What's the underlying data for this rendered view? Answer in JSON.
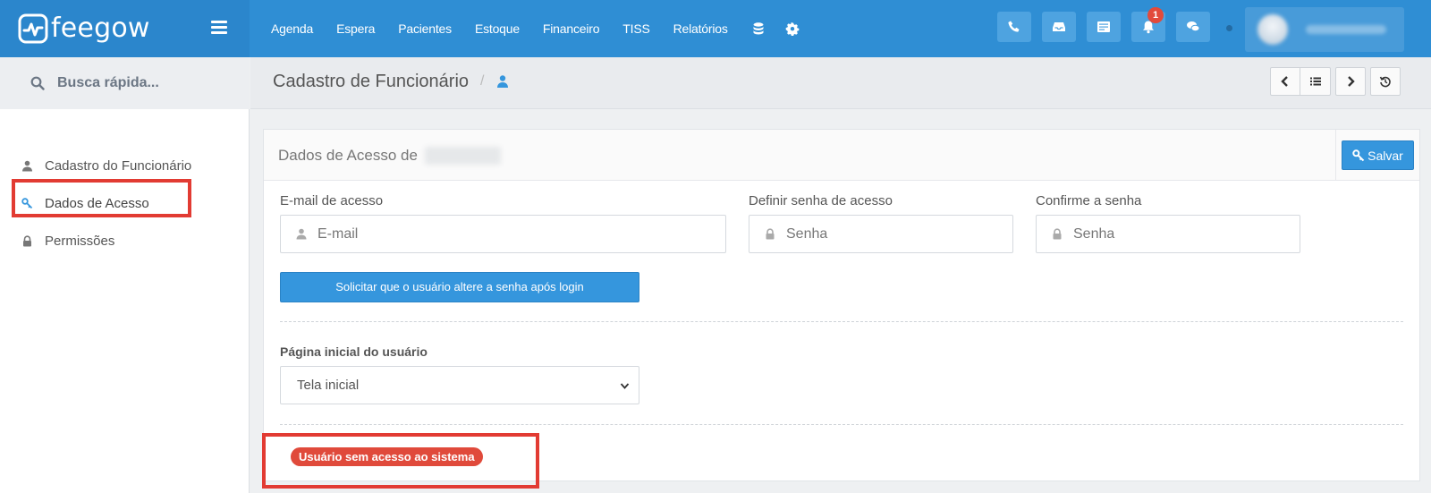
{
  "brand": {
    "name": "feegow"
  },
  "nav": {
    "items": [
      "Agenda",
      "Espera",
      "Pacientes",
      "Estoque",
      "Financeiro",
      "TISS",
      "Relatórios"
    ],
    "icons": [
      "database-icon",
      "gear-icon"
    ]
  },
  "toolbar": {
    "notification_count": "1",
    "buttons": [
      "phone-icon",
      "inbox-icon",
      "list-card-icon",
      "bell-icon",
      "chat-icon"
    ]
  },
  "sidebar": {
    "search_placeholder": "Busca rápida...",
    "items": [
      {
        "label": "Cadastro do Funcionário",
        "icon": "user-icon"
      },
      {
        "label": "Dados de Acesso",
        "icon": "key-icon",
        "active": true
      },
      {
        "label": "Permissões",
        "icon": "lock-icon"
      }
    ]
  },
  "page": {
    "title": "Cadastro de Funcionário",
    "breadcrumb_sep": "/"
  },
  "panel": {
    "title": "Dados de Acesso de",
    "save_label": "Salvar",
    "email_label": "E-mail de acesso",
    "email_placeholder": "E-mail",
    "password_label": "Definir senha de acesso",
    "password_placeholder": "Senha",
    "confirm_label": "Confirme a senha",
    "confirm_placeholder": "Senha",
    "force_change_label": "Solicitar que o usuário altere a senha após login",
    "homepage_label": "Página inicial do usuário",
    "homepage_value": "Tela inicial",
    "status_text": "Usuário sem acesso ao sistema"
  },
  "colors": {
    "primary": "#2f8ed4",
    "button": "#3596dd",
    "danger": "#e04a3b",
    "highlight": "#e23b33"
  }
}
